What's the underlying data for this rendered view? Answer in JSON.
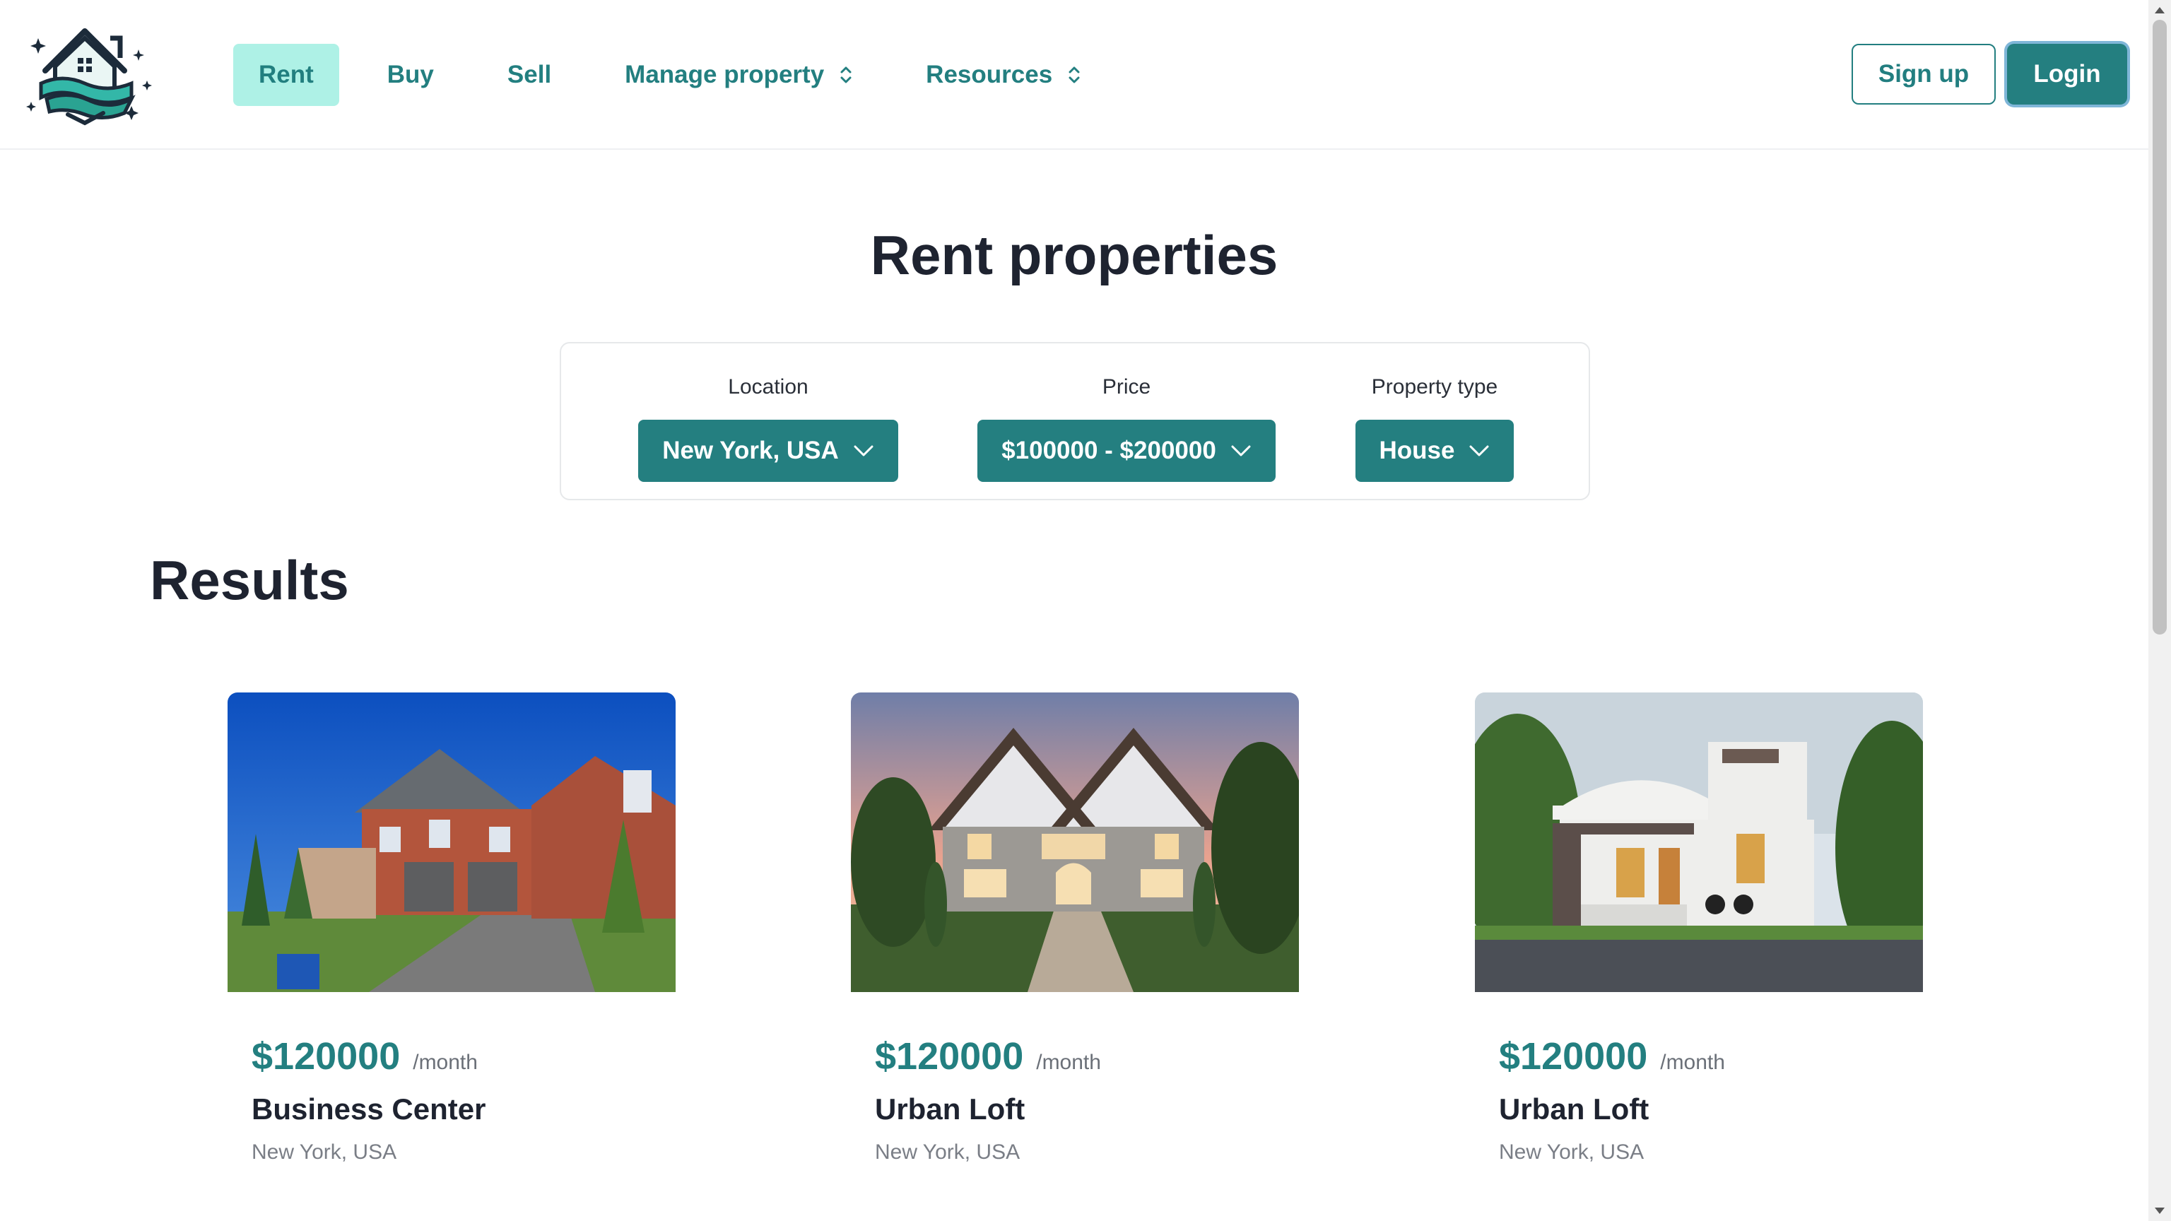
{
  "colors": {
    "brand": "#247f80",
    "nav_active_bg": "#aef1e6",
    "text_dark": "#1e2330",
    "text_muted": "#7a7e86"
  },
  "header": {
    "logo": "house-waves-logo",
    "nav": [
      {
        "label": "Rent",
        "active": true
      },
      {
        "label": "Buy",
        "active": false
      },
      {
        "label": "Sell",
        "active": false
      },
      {
        "label": "Manage property",
        "active": false,
        "icon": "sort-icon"
      },
      {
        "label": "Resources",
        "active": false,
        "icon": "sort-icon"
      }
    ],
    "signup_label": "Sign up",
    "login_label": "Login"
  },
  "page": {
    "title": "Rent properties"
  },
  "filters": {
    "location": {
      "label": "Location",
      "value": "New York, USA"
    },
    "price": {
      "label": "Price",
      "value": "$100000 - $200000"
    },
    "type": {
      "label": "Property type",
      "value": "House"
    }
  },
  "results": {
    "title": "Results",
    "cards": [
      {
        "image": "brick-suburban-house-photo",
        "price": "$120000",
        "period": "/month",
        "name": "Business Center",
        "location": "New York, USA"
      },
      {
        "image": "stone-tudor-house-sunset-photo",
        "price": "$120000",
        "period": "/month",
        "name": "Urban Loft",
        "location": "New York, USA"
      },
      {
        "image": "modern-white-villa-photo",
        "price": "$120000",
        "period": "/month",
        "name": "Urban Loft",
        "location": "New York, USA"
      }
    ]
  }
}
